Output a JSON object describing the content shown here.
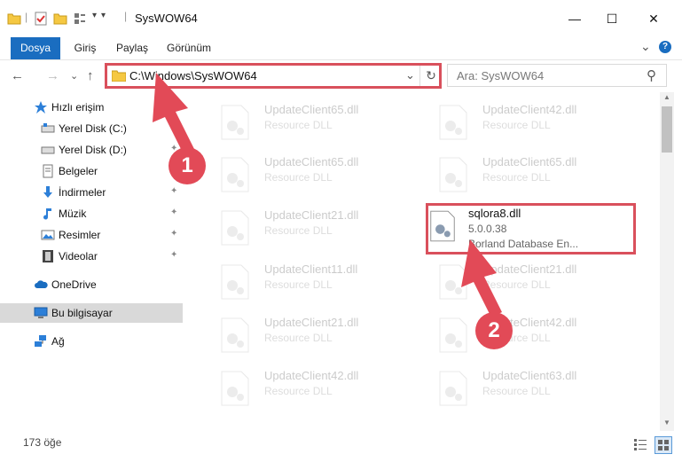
{
  "window": {
    "title": "SysWOW64",
    "minimize": "—",
    "maximize": "☐",
    "close": "✕"
  },
  "ribbon": {
    "tabs": [
      "Dosya",
      "Giriş",
      "Paylaş",
      "Görünüm"
    ],
    "expand": "⌄",
    "help": "?"
  },
  "nav": {
    "back": "←",
    "forward": "→",
    "recent": "⌄",
    "up": "↑",
    "address": "C:\\Windows\\SysWOW64",
    "dropdown": "⌄",
    "refresh": "↻",
    "search_placeholder": "Ara: SysWOW64",
    "search_icon": "⚲"
  },
  "sidebar": {
    "items": [
      {
        "label": "Hızlı erişim",
        "icon": "star-icon"
      },
      {
        "label": "Yerel Disk (C:)",
        "icon": "drive-icon",
        "pinned": true
      },
      {
        "label": "Yerel Disk (D:)",
        "icon": "drive-icon",
        "pinned": true
      },
      {
        "label": "Belgeler",
        "icon": "document-icon",
        "pinned": true
      },
      {
        "label": "İndirmeler",
        "icon": "download-icon",
        "pinned": true
      },
      {
        "label": "Müzik",
        "icon": "music-icon",
        "pinned": true
      },
      {
        "label": "Resimler",
        "icon": "pictures-icon",
        "pinned": true
      },
      {
        "label": "Videolar",
        "icon": "video-icon",
        "pinned": true
      },
      {
        "label": "OneDrive",
        "icon": "cloud-icon"
      },
      {
        "label": "Bu bilgisayar",
        "icon": "computer-icon",
        "selected": true
      },
      {
        "label": "Ağ",
        "icon": "network-icon"
      }
    ],
    "pin_glyph": "📌"
  },
  "files": [
    {
      "name": "UpdateClient65.dll",
      "desc": "Resource DLL"
    },
    {
      "name": "UpdateClient42.dll",
      "desc": "Resource DLL"
    },
    {
      "name": "UpdateClient65.dll",
      "desc": "Resource DLL"
    },
    {
      "name": "UpdateClient65.dll",
      "desc": "Resource DLL"
    },
    {
      "name": "UpdateClient21.dll",
      "desc": "Resource DLL"
    },
    {
      "name": "sqlora8.dll",
      "desc": "5.0.0.38",
      "desc2": "Borland Database En...",
      "highlighted": true
    },
    {
      "name": "UpdateClient11.dll",
      "desc": "Resource DLL"
    },
    {
      "name": "UpdateClient21.dll",
      "desc": "Resource DLL"
    },
    {
      "name": "UpdateClient21.dll",
      "desc": "Resource DLL"
    },
    {
      "name": "UpdateClient42.dll",
      "desc": "Resource DLL"
    },
    {
      "name": "UpdateClient42.dll",
      "desc": "Resource DLL"
    },
    {
      "name": "UpdateClient63.dll",
      "desc": "Resource DLL"
    }
  ],
  "status": {
    "count": "173 öğe"
  },
  "annotations": {
    "step1": "1",
    "step2": "2",
    "color": "#e24a57"
  },
  "colors": {
    "accent": "#1a6dc0",
    "folder": "#f5c842",
    "annotation": "#e24a57"
  }
}
